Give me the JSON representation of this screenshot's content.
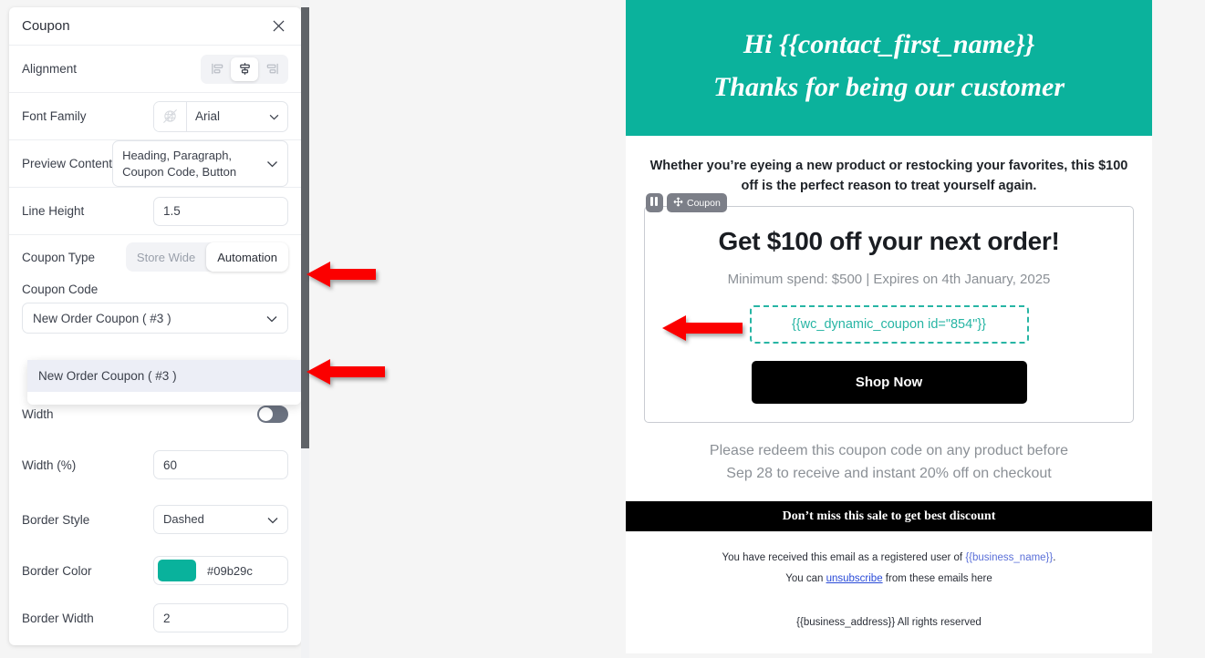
{
  "settings_panel": {
    "title": "Coupon",
    "close_icon": "close-icon",
    "rows": {
      "alignment": {
        "label": "Alignment",
        "options": [
          "align-left-icon",
          "align-center-icon",
          "align-right-icon"
        ],
        "selected_index": 1
      },
      "font_family": {
        "label": "Font Family",
        "globe_icon": "globe-slash-icon",
        "value": "Arial"
      },
      "preview_content": {
        "label": "Preview Content",
        "value": "Heading, Paragraph, Coupon Code, Button"
      },
      "line_height": {
        "label": "Line Height",
        "value": "1.5"
      },
      "coupon_type": {
        "label": "Coupon Type",
        "options": [
          "Store Wide",
          "Automation"
        ],
        "selected": "Automation"
      },
      "coupon_code": {
        "label": "Coupon Code",
        "value": "New Order Coupon ( #3 )",
        "dropdown_open": true,
        "options": [
          "New Order Coupon ( #3 )"
        ]
      },
      "width_toggle": {
        "label": "Width",
        "state": "off"
      },
      "width_percent": {
        "label": "Width (%)",
        "value": "60"
      },
      "border_style": {
        "label": "Border Style",
        "value": "Dashed"
      },
      "border_color": {
        "label": "Border Color",
        "value": "#09b29c",
        "swatch": "#09b29c"
      },
      "border_width": {
        "label": "Border Width",
        "value": "2"
      }
    }
  },
  "email_preview": {
    "hero": {
      "line1": "Hi {{contact_first_name}}",
      "line2": "Thanks for being our customer",
      "background": "#0bb29c"
    },
    "intro": "Whether you’re eyeing a new product or restocking your favorites, this $100 off is the perfect reason to treat yourself again.",
    "badges": {
      "drag_icon": "drag-handle-icon",
      "move_icon": "move-arrows-icon",
      "label": "Coupon"
    },
    "coupon_card": {
      "heading": "Get $100 off your next order!",
      "subtext": "Minimum spend: $500 | Expires on 4th January, 2025",
      "code": "{{wc_dynamic_coupon id=\"854\"}}",
      "code_color": "#27b5a4",
      "button_label": "Shop Now"
    },
    "redeem": {
      "line1": "Please redeem this coupon code on any product before",
      "line2": "Sep 28 to receive and instant 20% off on checkout"
    },
    "black_bar": "Don’t miss this sale to get best discount",
    "footer": {
      "line1_before": "You have received this email as a registered user of ",
      "line1_var": "{{business_name}}",
      "line1_after": ".",
      "line2_before": "You can ",
      "line2_link": "unsubscribe",
      "line2_after": " from these emails here",
      "address": "{{business_address}}  All rights reserved"
    }
  },
  "annotations": {
    "arrow1_target": "Coupon Type Automation toggle",
    "arrow2_target": "Coupon Code dropdown option",
    "arrow3_target": "Coupon code box in preview",
    "color": "#fb0000"
  }
}
